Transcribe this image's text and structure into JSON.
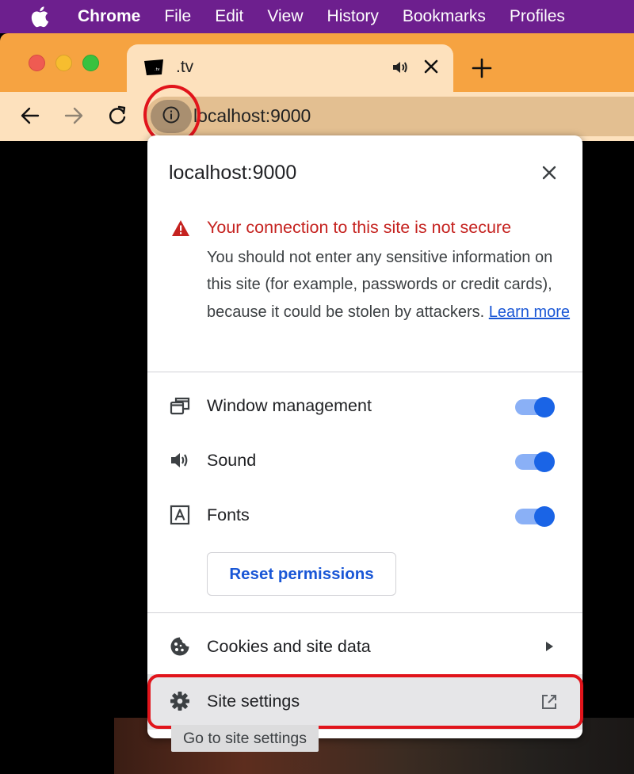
{
  "menu_bar": {
    "app_name": "Chrome",
    "items": [
      "File",
      "Edit",
      "View",
      "History",
      "Bookmarks",
      "Profiles"
    ]
  },
  "tab": {
    "title": ".tv"
  },
  "toolbar": {
    "url": "localhost:9000"
  },
  "page_info": {
    "host": "localhost:9000",
    "security_title": "Your connection to this site is not secure",
    "security_body": "You should not enter any sensitive information on this site (for example, passwords or credit cards), because it could be stolen by attackers.",
    "learn_more": "Learn more",
    "permissions": [
      {
        "label": "Window management",
        "icon": "window-management-icon",
        "enabled": true
      },
      {
        "label": "Sound",
        "icon": "speaker-icon",
        "enabled": true
      },
      {
        "label": "Fonts",
        "icon": "font-icon",
        "enabled": true
      }
    ],
    "reset_button": "Reset permissions",
    "cookies_label": "Cookies and site data",
    "site_settings_label": "Site settings",
    "tooltip": "Go to site settings"
  },
  "colors": {
    "menu_bar": "#6d1f8e",
    "tab_strip": "#f6a341",
    "toolbar": "#fde1bd",
    "warning_red": "#c5221f",
    "link_blue": "#1a57d6",
    "toggle_on": "#1a64e6",
    "highlight": "#e1141b"
  }
}
